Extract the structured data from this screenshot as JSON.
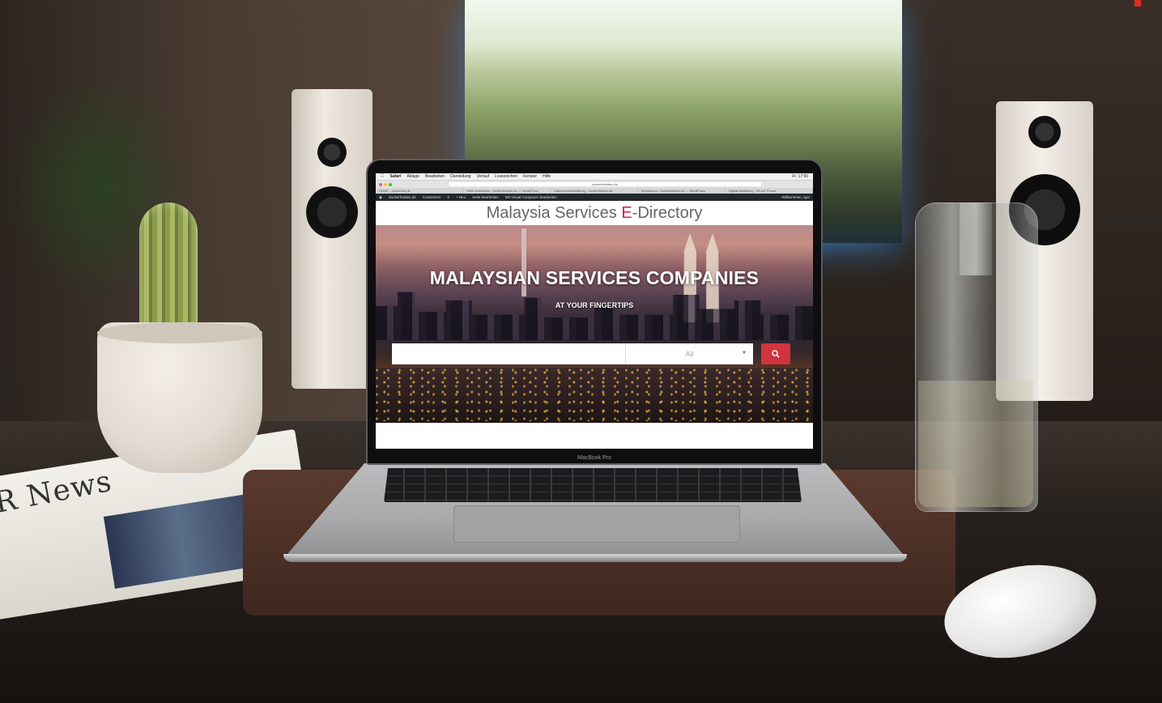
{
  "scene": {
    "objects": [
      "plant-icon",
      "cactus-icon",
      "speaker-icon",
      "tv-icon",
      "bottle-icon",
      "mouse-icon",
      "newspaper-icon",
      "laptop-icon"
    ]
  },
  "newspaper": {
    "masthead": "R News"
  },
  "laptop": {
    "model": "MacBook Pro"
  },
  "browser": {
    "menu": [
      "Safari",
      "Ablage",
      "Bearbeiten",
      "Darstellung",
      "Verlauf",
      "Lesezeichen",
      "Fenster",
      "Hilfe"
    ],
    "url": "zuckerlosleben.de",
    "tabs": [
      "HOME - Zuckerfrei.de",
      "Seite bearbeiten ‹ Zuckerfreiden.de — WordPress",
      "Datenschutzerklärung - Zuckerfreiden.de",
      "Impressum ‹ Zuckerfreiden.de — WordPress",
      "Digital Marketing - SE-UX Phone"
    ],
    "clock": "Fr. 17:56",
    "window_colors": [
      "#fe5f57",
      "#febc2e",
      "#28c840"
    ]
  },
  "wp_admin_bar": {
    "items": [
      "Zuckerfreiden.de",
      "Customizer",
      "0",
      "+ Neu",
      "Seite bearbeiten",
      "Mit Visual Composer bearbeiten"
    ],
    "greeting": "Willkommen, Igor"
  },
  "site": {
    "title_prefix": "Malaysia Services ",
    "title_accent": "E",
    "title_suffix": "-Directory",
    "accent_color": "#d1273a"
  },
  "hero": {
    "headline": "MALAYSIAN SERVICES COMPANIES",
    "subline": "AT YOUR FINGERTIPS"
  },
  "search": {
    "input_value": "",
    "category_selected": "All",
    "button_icon": "search-icon",
    "button_color": "#d1343f"
  }
}
